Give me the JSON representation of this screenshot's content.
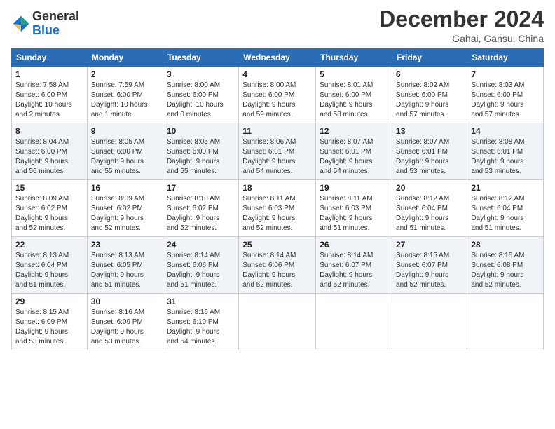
{
  "header": {
    "logo_line1": "General",
    "logo_line2": "Blue",
    "month_title": "December 2024",
    "location": "Gahai, Gansu, China"
  },
  "days_of_week": [
    "Sunday",
    "Monday",
    "Tuesday",
    "Wednesday",
    "Thursday",
    "Friday",
    "Saturday"
  ],
  "weeks": [
    [
      {
        "day": "1",
        "info": "Sunrise: 7:58 AM\nSunset: 6:00 PM\nDaylight: 10 hours\nand 2 minutes."
      },
      {
        "day": "2",
        "info": "Sunrise: 7:59 AM\nSunset: 6:00 PM\nDaylight: 10 hours\nand 1 minute."
      },
      {
        "day": "3",
        "info": "Sunrise: 8:00 AM\nSunset: 6:00 PM\nDaylight: 10 hours\nand 0 minutes."
      },
      {
        "day": "4",
        "info": "Sunrise: 8:00 AM\nSunset: 6:00 PM\nDaylight: 9 hours\nand 59 minutes."
      },
      {
        "day": "5",
        "info": "Sunrise: 8:01 AM\nSunset: 6:00 PM\nDaylight: 9 hours\nand 58 minutes."
      },
      {
        "day": "6",
        "info": "Sunrise: 8:02 AM\nSunset: 6:00 PM\nDaylight: 9 hours\nand 57 minutes."
      },
      {
        "day": "7",
        "info": "Sunrise: 8:03 AM\nSunset: 6:00 PM\nDaylight: 9 hours\nand 57 minutes."
      }
    ],
    [
      {
        "day": "8",
        "info": "Sunrise: 8:04 AM\nSunset: 6:00 PM\nDaylight: 9 hours\nand 56 minutes."
      },
      {
        "day": "9",
        "info": "Sunrise: 8:05 AM\nSunset: 6:00 PM\nDaylight: 9 hours\nand 55 minutes."
      },
      {
        "day": "10",
        "info": "Sunrise: 8:05 AM\nSunset: 6:00 PM\nDaylight: 9 hours\nand 55 minutes."
      },
      {
        "day": "11",
        "info": "Sunrise: 8:06 AM\nSunset: 6:01 PM\nDaylight: 9 hours\nand 54 minutes."
      },
      {
        "day": "12",
        "info": "Sunrise: 8:07 AM\nSunset: 6:01 PM\nDaylight: 9 hours\nand 54 minutes."
      },
      {
        "day": "13",
        "info": "Sunrise: 8:07 AM\nSunset: 6:01 PM\nDaylight: 9 hours\nand 53 minutes."
      },
      {
        "day": "14",
        "info": "Sunrise: 8:08 AM\nSunset: 6:01 PM\nDaylight: 9 hours\nand 53 minutes."
      }
    ],
    [
      {
        "day": "15",
        "info": "Sunrise: 8:09 AM\nSunset: 6:02 PM\nDaylight: 9 hours\nand 52 minutes."
      },
      {
        "day": "16",
        "info": "Sunrise: 8:09 AM\nSunset: 6:02 PM\nDaylight: 9 hours\nand 52 minutes."
      },
      {
        "day": "17",
        "info": "Sunrise: 8:10 AM\nSunset: 6:02 PM\nDaylight: 9 hours\nand 52 minutes."
      },
      {
        "day": "18",
        "info": "Sunrise: 8:11 AM\nSunset: 6:03 PM\nDaylight: 9 hours\nand 52 minutes."
      },
      {
        "day": "19",
        "info": "Sunrise: 8:11 AM\nSunset: 6:03 PM\nDaylight: 9 hours\nand 51 minutes."
      },
      {
        "day": "20",
        "info": "Sunrise: 8:12 AM\nSunset: 6:04 PM\nDaylight: 9 hours\nand 51 minutes."
      },
      {
        "day": "21",
        "info": "Sunrise: 8:12 AM\nSunset: 6:04 PM\nDaylight: 9 hours\nand 51 minutes."
      }
    ],
    [
      {
        "day": "22",
        "info": "Sunrise: 8:13 AM\nSunset: 6:04 PM\nDaylight: 9 hours\nand 51 minutes."
      },
      {
        "day": "23",
        "info": "Sunrise: 8:13 AM\nSunset: 6:05 PM\nDaylight: 9 hours\nand 51 minutes."
      },
      {
        "day": "24",
        "info": "Sunrise: 8:14 AM\nSunset: 6:06 PM\nDaylight: 9 hours\nand 51 minutes."
      },
      {
        "day": "25",
        "info": "Sunrise: 8:14 AM\nSunset: 6:06 PM\nDaylight: 9 hours\nand 52 minutes."
      },
      {
        "day": "26",
        "info": "Sunrise: 8:14 AM\nSunset: 6:07 PM\nDaylight: 9 hours\nand 52 minutes."
      },
      {
        "day": "27",
        "info": "Sunrise: 8:15 AM\nSunset: 6:07 PM\nDaylight: 9 hours\nand 52 minutes."
      },
      {
        "day": "28",
        "info": "Sunrise: 8:15 AM\nSunset: 6:08 PM\nDaylight: 9 hours\nand 52 minutes."
      }
    ],
    [
      {
        "day": "29",
        "info": "Sunrise: 8:15 AM\nSunset: 6:09 PM\nDaylight: 9 hours\nand 53 minutes."
      },
      {
        "day": "30",
        "info": "Sunrise: 8:16 AM\nSunset: 6:09 PM\nDaylight: 9 hours\nand 53 minutes."
      },
      {
        "day": "31",
        "info": "Sunrise: 8:16 AM\nSunset: 6:10 PM\nDaylight: 9 hours\nand 54 minutes."
      },
      {
        "day": "",
        "info": ""
      },
      {
        "day": "",
        "info": ""
      },
      {
        "day": "",
        "info": ""
      },
      {
        "day": "",
        "info": ""
      }
    ]
  ]
}
